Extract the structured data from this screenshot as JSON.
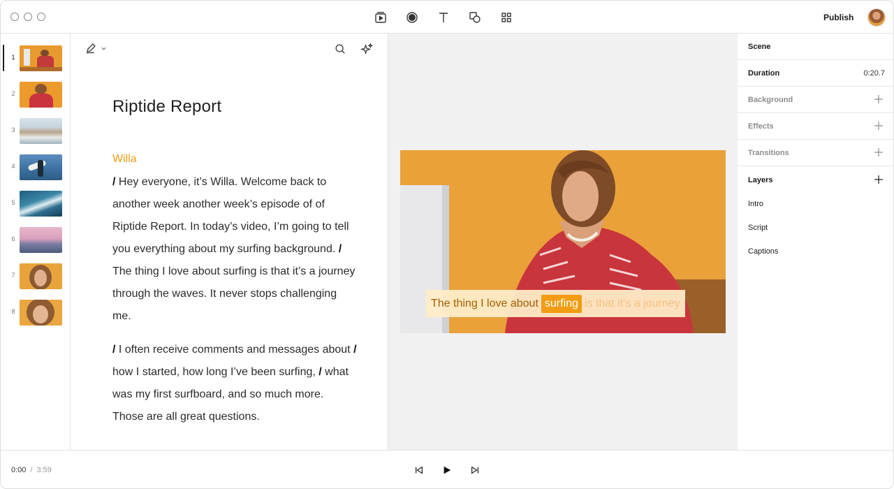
{
  "topbar": {
    "tools": [
      {
        "name": "media-icon"
      },
      {
        "name": "record-icon"
      },
      {
        "name": "text-icon"
      },
      {
        "name": "shapes-icon"
      },
      {
        "name": "grid-icon"
      }
    ],
    "publish_label": "Publish",
    "avatar_icon": "user-avatar"
  },
  "scenes": [
    {
      "number": "1",
      "thumb": "woman-at-computer-orange",
      "active": true
    },
    {
      "number": "2",
      "thumb": "woman-orange-background"
    },
    {
      "number": "3",
      "thumb": "beach-aerial"
    },
    {
      "number": "4",
      "thumb": "surfer-carrying-board"
    },
    {
      "number": "5",
      "thumb": "wave"
    },
    {
      "number": "6",
      "thumb": "pink-sky-ocean"
    },
    {
      "number": "7",
      "thumb": "woman-portrait"
    },
    {
      "number": "8",
      "thumb": "woman-portrait-closeup"
    }
  ],
  "editor": {
    "title": "Riptide Report",
    "speaker": "Willa",
    "paragraphs": [
      [
        {
          "t": "/ ",
          "bold": true
        },
        {
          "t": "Hey everyone, it’s Willa. Welcome back to another week another week’s episode of of Riptide Report. In today’s video, I’m going to tell you everything about my surfing background. "
        },
        {
          "t": "/ ",
          "bold": true
        },
        {
          "t": "The thing  I love about surfing is that it’s a  journey through the waves. It never stops challenging me."
        }
      ],
      [
        {
          "t": "/ ",
          "bold": true
        },
        {
          "t": "I often receive comments and messages about  "
        },
        {
          "t": "/ ",
          "bold": true
        },
        {
          "t": "how I started, how long I’ve been surfing, "
        },
        {
          "t": "/ ",
          "bold": true
        },
        {
          "t": "what was my first surfboard, and so much more. Those are all great questions."
        }
      ]
    ]
  },
  "preview": {
    "caption": {
      "spoken": "The thing  I love about",
      "current": "surfing",
      "upcoming": "is that it’s a  journey"
    }
  },
  "inspector": {
    "scene_label": "Scene",
    "duration_label": "Duration",
    "duration_value": "0:20.7",
    "background_label": "Background",
    "effects_label": "Effects",
    "transitions_label": "Transitions",
    "layers_label": "Layers",
    "layers": [
      "Intro",
      "Script",
      "Captions"
    ]
  },
  "playback": {
    "current_time": "0:00",
    "separator": "/",
    "total_time": "3:59"
  }
}
